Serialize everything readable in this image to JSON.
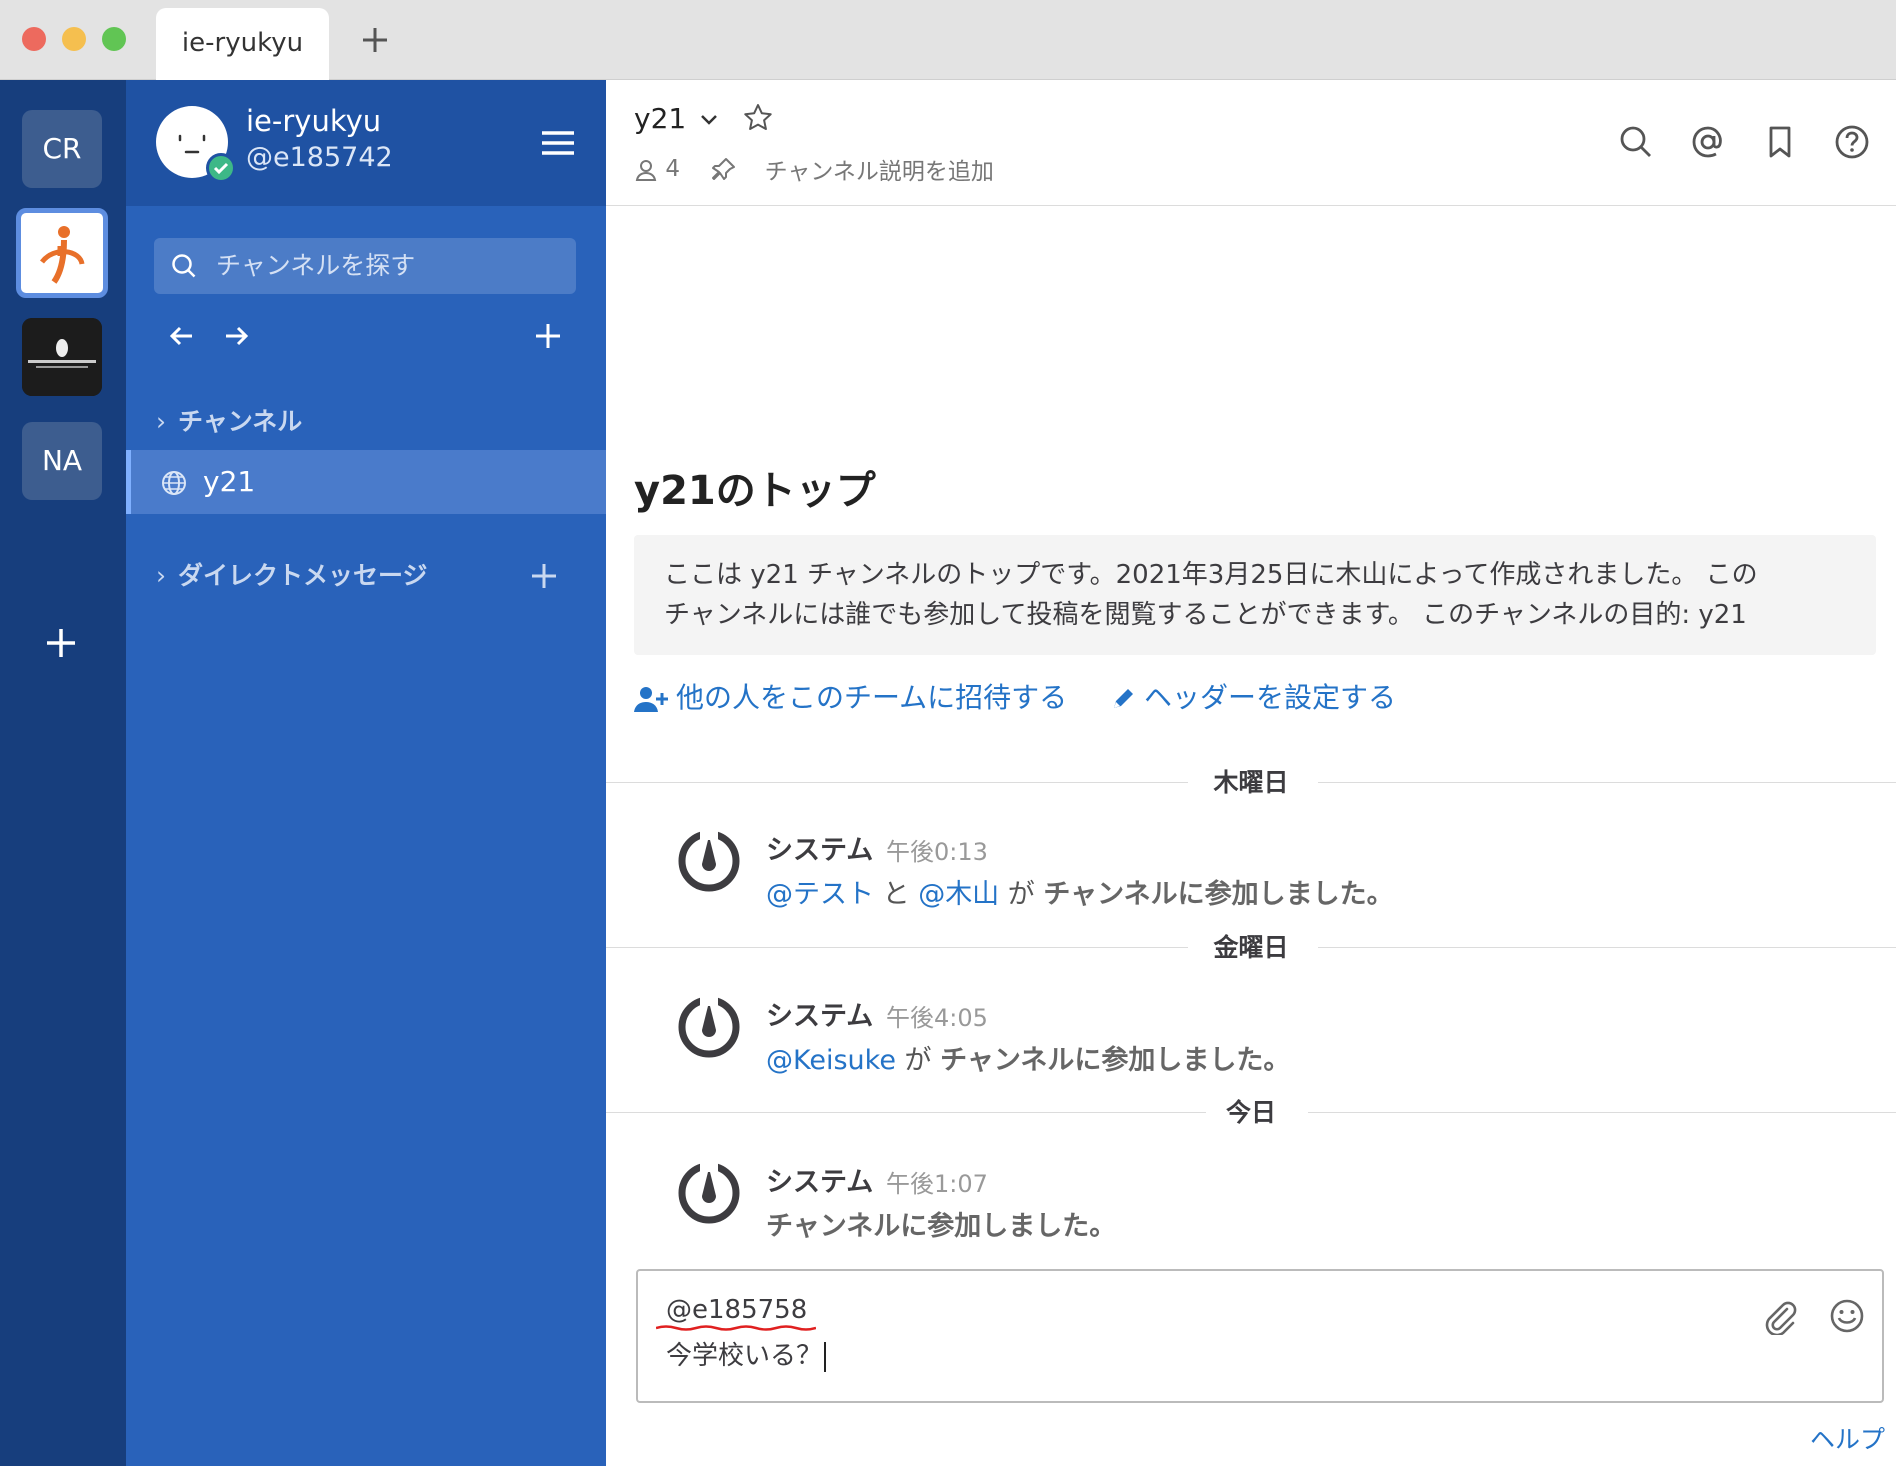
{
  "window": {
    "tab_title": "ie-ryukyu",
    "new_tab_label": "+"
  },
  "teams": {
    "items": [
      {
        "label": "CR"
      },
      {
        "label": ""
      },
      {
        "label": ""
      },
      {
        "label": "NA"
      }
    ],
    "add_label": "+"
  },
  "sidebar": {
    "team_name": "ie-ryukyu",
    "username": "@e185742",
    "search_placeholder": "チャンネルを探す",
    "channels_section": "チャンネル",
    "channel_active": "y21",
    "dm_section": "ダイレクトメッセージ"
  },
  "channel_header": {
    "name": "y21",
    "member_count": "4",
    "description_placeholder": "チャンネル説明を追加"
  },
  "intro": {
    "title": "y21のトップ",
    "line1": "ここは y21 チャンネルのトップです。2021年3月25日に木山によって作成されました。 この",
    "line2": "チャンネルには誰でも参加して投稿を閲覧することができます。 このチャンネルの目的: y21",
    "invite_link": "他の人をこのチームに招待する",
    "header_link": "ヘッダーを設定する"
  },
  "posts": [
    {
      "date": "木曜日",
      "author": "システム",
      "time": "午後0:13",
      "mention1": "@テスト",
      "conj": "と",
      "mention2": "@木山",
      "ga": "が",
      "text": "チャンネルに参加しました。"
    },
    {
      "date": "金曜日",
      "author": "システム",
      "time": "午後4:05",
      "mention1": "@Keisuke",
      "ga": "が",
      "text": "チャンネルに参加しました。"
    },
    {
      "date": "今日",
      "author": "システム",
      "time": "午後1:07",
      "text": "チャンネルに参加しました。"
    }
  ],
  "composer": {
    "line1": "@e185758",
    "line2": "今学校いる？"
  },
  "footer": {
    "help_link": "ヘルプ"
  },
  "colors": {
    "teams_bg": "#173e7d",
    "sidebar_bg": "#2962ba",
    "link": "#2473c7"
  }
}
